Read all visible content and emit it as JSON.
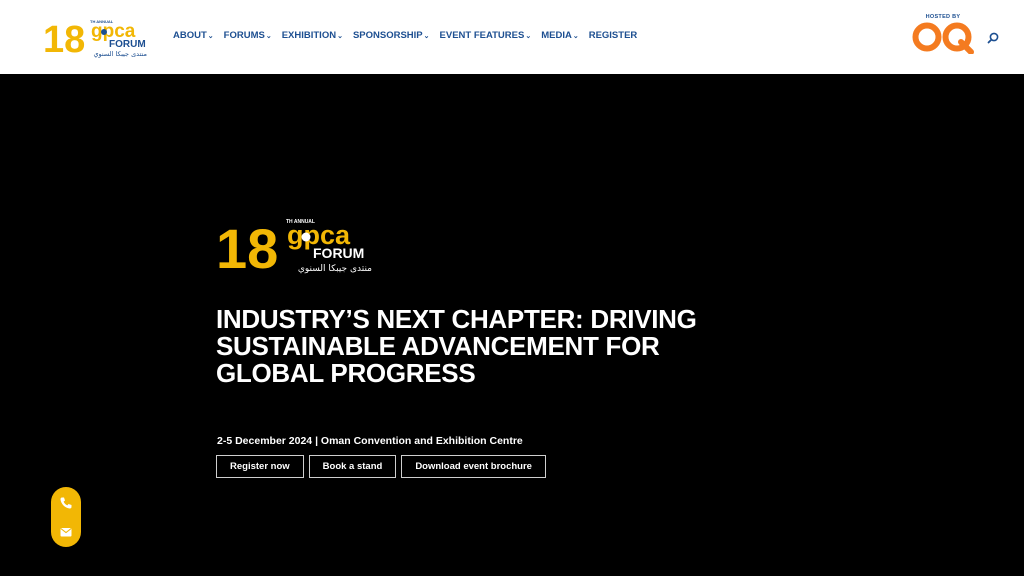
{
  "brand": {
    "number": "18",
    "superscript": "TH ANNUAL",
    "wordmark": "gpca",
    "sub": "FORUM",
    "arabic": "منتدى جيبكا السنوي",
    "color_gold": "#f2b705",
    "color_blue": "#1d4f91"
  },
  "nav": {
    "items": [
      {
        "label": "ABOUT",
        "dropdown": true
      },
      {
        "label": "FORUMS",
        "dropdown": true
      },
      {
        "label": "EXHIBITION",
        "dropdown": true
      },
      {
        "label": "SPONSORSHIP",
        "dropdown": true
      },
      {
        "label": "EVENT FEATURES",
        "dropdown": true
      },
      {
        "label": "MEDIA",
        "dropdown": true
      },
      {
        "label": "REGISTER",
        "dropdown": false
      }
    ],
    "chevron": "⌄"
  },
  "host": {
    "label": "HOSTED BY",
    "logo_text": "OQ",
    "color": "#f47b20"
  },
  "search": {
    "icon": "search-icon"
  },
  "hero": {
    "headline": [
      "INDUSTRY’S NEXT CHAPTER: DRIVING",
      "SUSTAINABLE ADVANCEMENT FOR",
      "GLOBAL PROGRESS"
    ],
    "date_location": "2-5 December 2024 | Oman Convention and Exhibition Centre",
    "buttons": [
      {
        "label": "Register now"
      },
      {
        "label": "Book a stand"
      },
      {
        "label": "Download event brochure"
      }
    ]
  },
  "contact": {
    "phone_icon": "phone-icon",
    "email_icon": "email-icon"
  }
}
